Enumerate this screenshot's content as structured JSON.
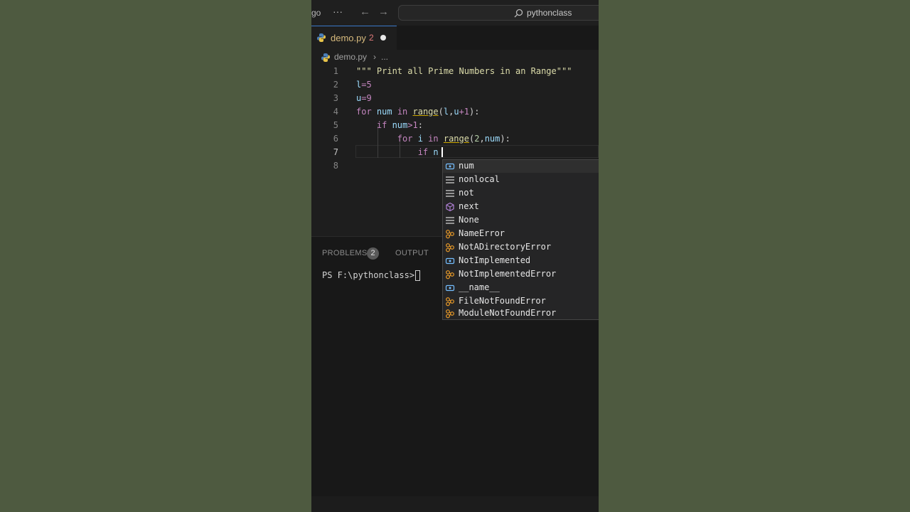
{
  "titlebar": {
    "left_text": "go",
    "more": "···",
    "back": "←",
    "forward": "→",
    "search_text": "pythonclass"
  },
  "tab": {
    "filename": "demo.py",
    "problem_count": "2"
  },
  "breadcrumb": {
    "file": "demo.py",
    "separator": "›",
    "more": "..."
  },
  "editor": {
    "line_numbers": [
      "1",
      "2",
      "3",
      "4",
      "5",
      "6",
      "7",
      "8"
    ],
    "lines": {
      "l1": "\"\"\" Print all Prime Numbers in an Range\"\"\"",
      "l2_var": "l",
      "l2_op": "=",
      "l2_val": "5",
      "l3_var": "u",
      "l3_op": "=",
      "l3_val": "9",
      "l4_for": "for",
      "l4_var": " num ",
      "l4_in": "in",
      "l4_sp": " ",
      "l4_fn": "range",
      "l4_open": "(",
      "l4_a": "l",
      "l4_comma": ",",
      "l4_b": "u",
      "l4_plus": "+",
      "l4_one": "1",
      "l4_close": "):",
      "l5_if": "if",
      "l5_var": " num",
      "l5_op": ">",
      "l5_val": "1",
      "l5_colon": ":",
      "l6_for": "for",
      "l6_var": " i ",
      "l6_in": "in",
      "l6_sp": " ",
      "l6_fn": "range",
      "l6_open": "(",
      "l6_two": "2",
      "l6_comma": ",",
      "l6_num": "num",
      "l6_close": "):",
      "l7_if": "if",
      "l7_text": " n"
    }
  },
  "suggestions": [
    {
      "label": "num",
      "icon": "variable-icon"
    },
    {
      "label": "nonlocal",
      "icon": "keyword-icon"
    },
    {
      "label": "not",
      "icon": "keyword-icon"
    },
    {
      "label": "next",
      "icon": "method-icon"
    },
    {
      "label": "None",
      "icon": "keyword-icon"
    },
    {
      "label": "NameError",
      "icon": "class-icon"
    },
    {
      "label": "NotADirectoryError",
      "icon": "class-icon"
    },
    {
      "label": "NotImplemented",
      "icon": "variable-icon"
    },
    {
      "label": "NotImplementedError",
      "icon": "class-icon"
    },
    {
      "label": "__name__",
      "icon": "variable-icon"
    },
    {
      "label": "FileNotFoundError",
      "icon": "class-icon"
    },
    {
      "label": "ModuleNotFoundError",
      "icon": "class-icon"
    }
  ],
  "panel": {
    "problems_label": "PROBLEMS",
    "problems_count": "2",
    "output_label": "OUTPUT",
    "terminal_prompt": "PS F:\\pythonclass> "
  },
  "colors": {
    "background": "#4e5a40",
    "keyword_control": "#c586c0",
    "function": "#dcdcaa",
    "number": "#b5cea8",
    "string": "#ce9178",
    "variable": "#9cdcfe"
  }
}
